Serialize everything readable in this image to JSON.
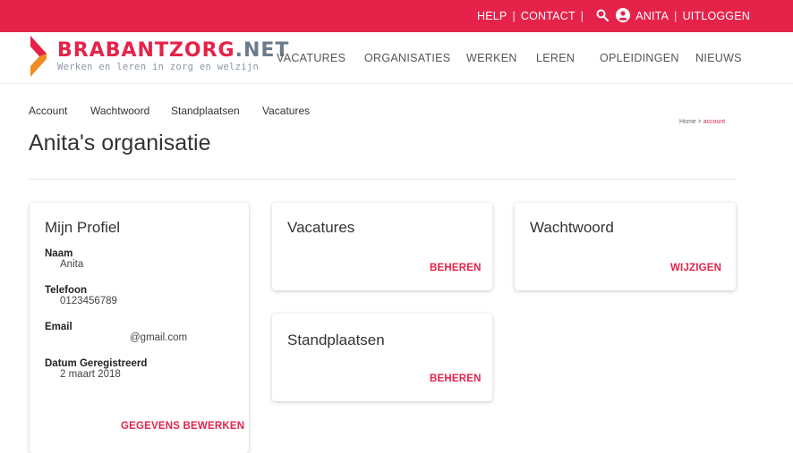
{
  "topbar": {
    "help": "HELP",
    "contact": "CONTACT",
    "user": "ANITA",
    "logout": "UITLOGGEN",
    "separator": "|"
  },
  "logo": {
    "brand_part1": "BRABANTZORG",
    "brand_part2": ".NET",
    "tagline": "Werken en leren in zorg en welzijn"
  },
  "nav": [
    "VACATURES",
    "ORGANISATIES",
    "WERKEN",
    "LEREN",
    "OPLEIDINGEN",
    "NIEUWS"
  ],
  "subnav": [
    "Account",
    "Wachtwoord",
    "Standplaatsen",
    "Vacatures"
  ],
  "breadcrumb": {
    "home": "Home",
    "sep": ">",
    "current": "account"
  },
  "page_title": "Anita's organisatie",
  "profile": {
    "title": "Mijn Profiel",
    "fields": [
      {
        "label": "Naam",
        "value": "Anita"
      },
      {
        "label": "Telefoon",
        "value": "0123456789"
      },
      {
        "label": "Email",
        "value": "@gmail.com"
      },
      {
        "label": "Datum Geregistreerd",
        "value": "2 maart 2018"
      }
    ],
    "action": "GEGEVENS BEWERKEN"
  },
  "cards": {
    "vacatures": {
      "title": "Vacatures",
      "action": "BEHEREN"
    },
    "wachtwoord": {
      "title": "Wachtwoord",
      "action": "WIJZIGEN"
    },
    "standplaatsen": {
      "title": "Standplaatsen",
      "action": "BEHEREN"
    }
  },
  "colors": {
    "accent": "#e5234a",
    "logo_grey": "#6b7b8c",
    "logo_orange": "#f08a24"
  }
}
